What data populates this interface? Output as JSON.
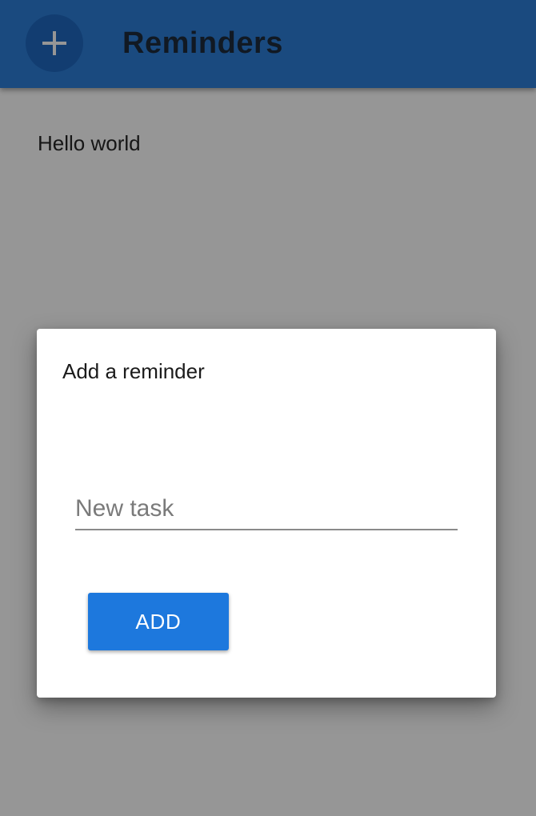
{
  "app_bar": {
    "title": "Reminders",
    "add_icon": "plus-icon",
    "background_color": "#2d7fd8"
  },
  "reminders": [
    {
      "text": "Hello world"
    }
  ],
  "dialog": {
    "title": "Add a reminder",
    "task_input": {
      "placeholder": "New task",
      "value": ""
    },
    "add_button_label": "ADD",
    "add_button_color": "#1d78dd"
  }
}
